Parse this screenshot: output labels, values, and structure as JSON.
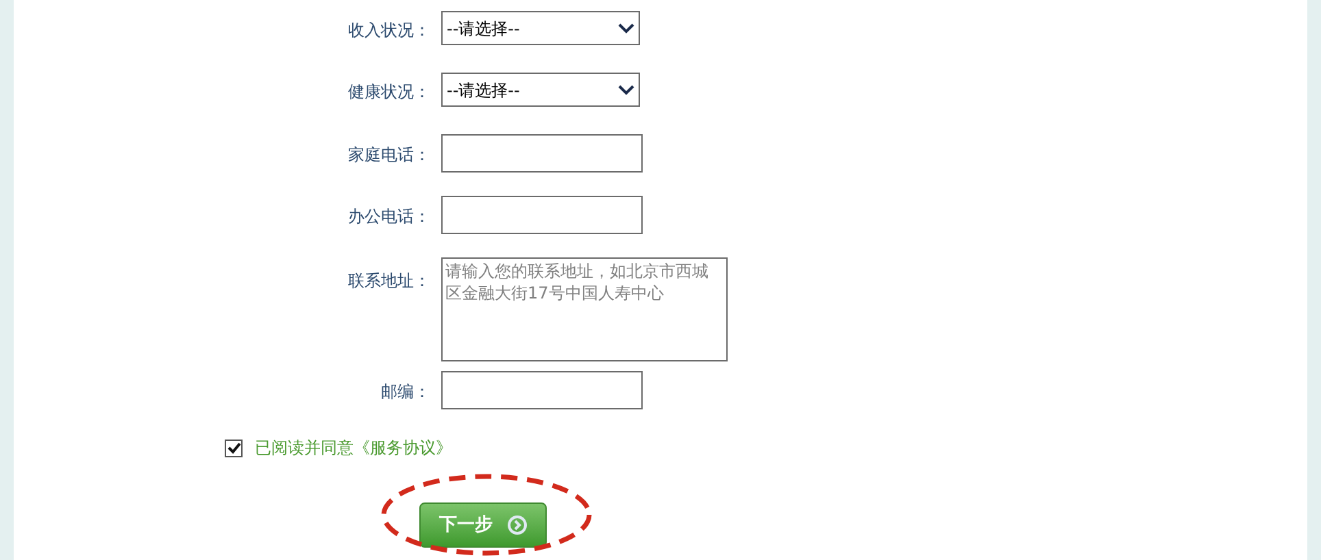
{
  "fields": [
    {
      "kind": "select",
      "label": "收入状况：",
      "value": "--请选择--"
    },
    {
      "kind": "select",
      "label": "健康状况：",
      "value": "--请选择--"
    },
    {
      "kind": "input",
      "label": "家庭电话："
    },
    {
      "kind": "input",
      "label": "办公电话："
    },
    {
      "kind": "textarea",
      "label": "联系地址：",
      "placeholder": "请输入您的联系地址，如北京市西城区金融大街17号中国人寿中心"
    },
    {
      "kind": "input",
      "label": "邮编："
    }
  ],
  "agreement": {
    "checked": true,
    "text": "已阅读并同意《服务协议》"
  },
  "next_button": {
    "label": "下一步",
    "highlighted": true
  }
}
